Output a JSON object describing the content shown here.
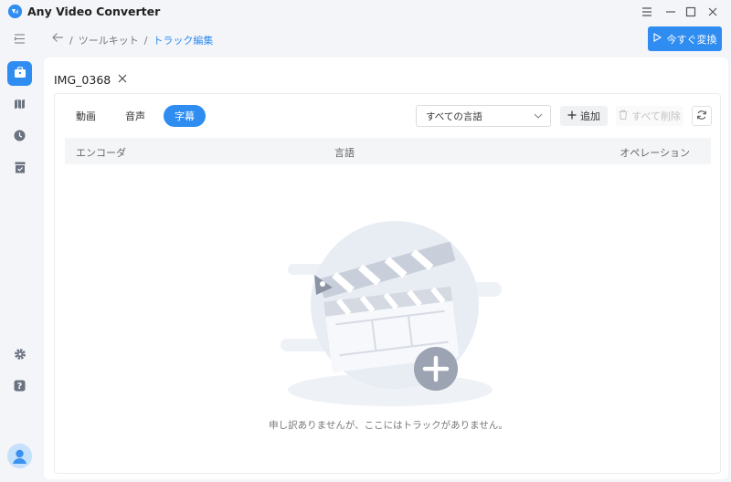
{
  "app": {
    "title": "Any Video Converter"
  },
  "window_controls": [
    "menu-icon",
    "minimize-icon",
    "maximize-icon",
    "close-icon"
  ],
  "sidebar": {
    "items": [
      {
        "icon": "collapse-menu-icon"
      },
      {
        "icon": "toolbox-icon",
        "active": true
      },
      {
        "icon": "map-icon"
      },
      {
        "icon": "history-icon"
      },
      {
        "icon": "checklist-icon"
      }
    ],
    "bottom": [
      {
        "icon": "gear-icon"
      },
      {
        "icon": "help-icon"
      }
    ]
  },
  "breadcrumb": {
    "items": [
      "ツールキット",
      "トラック編集"
    ],
    "separator": "/"
  },
  "header": {
    "convert_label": "今すぐ変換"
  },
  "file": {
    "name": "IMG_0368"
  },
  "tabs": [
    {
      "label": "動画",
      "active": false
    },
    {
      "label": "音声",
      "active": false
    },
    {
      "label": "字幕",
      "active": true
    }
  ],
  "language_select": {
    "value": "すべての言語"
  },
  "toolbar": {
    "add_label": "追加",
    "delete_all_label": "すべて削除"
  },
  "table": {
    "columns": [
      "エンコーダ",
      "言語",
      "オペレーション"
    ],
    "rows": []
  },
  "empty_state": {
    "message": "申し訳ありませんが、ここにはトラックがありません。"
  },
  "colors": {
    "accent": "#2f8cf0",
    "background": "#f3f5f9",
    "panel": "#ffffff"
  }
}
